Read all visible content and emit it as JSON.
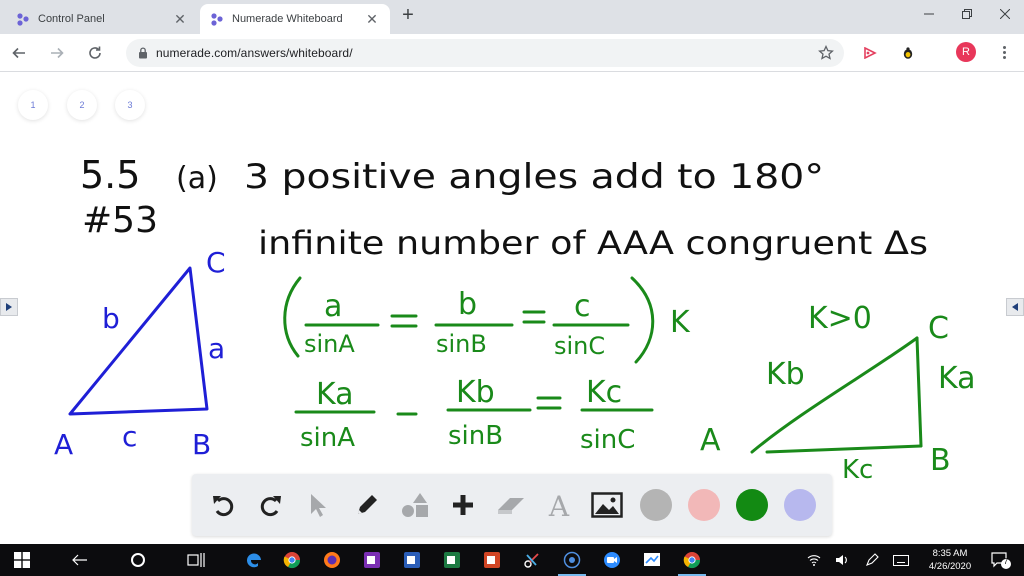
{
  "browser": {
    "tabs": [
      {
        "title": "Control Panel",
        "close": "✕"
      },
      {
        "title": "Numerade Whiteboard",
        "close": "✕"
      }
    ],
    "new_tab": "+",
    "url": "numerade.com/answers/whiteboard/",
    "profile_initial": "R"
  },
  "whiteboard": {
    "page_buttons": [
      "1",
      "2",
      "3"
    ],
    "notes": {
      "line1_section": "5.5",
      "line1_part": "(a)",
      "line1_text": "3 positive angles add to 180°",
      "line2_number": "#53",
      "line2_text": "infinite number of AAA congruent Δs",
      "tri1_vertex_c": "C",
      "tri1_vertex_a": "A",
      "tri1_vertex_b": "B",
      "tri1_side_b": "b",
      "tri1_side_a": "a",
      "tri1_side_c": "c",
      "eq1_num_a": "a",
      "eq1_den_a": "sinA",
      "eq1_num_b": "b",
      "eq1_den_b": "sinB",
      "eq1_num_c": "c",
      "eq1_den_c": "sinC",
      "eq1_factor": "K",
      "eq2_num_a": "Ka",
      "eq2_den_a": "sinA",
      "eq2_num_b": "Kb",
      "eq2_den_b": "sinB",
      "eq2_num_c": "Kc",
      "eq2_den_c": "sinC",
      "k_condition": "K>0",
      "tri2_vertex_c": "C",
      "tri2_vertex_a": "A",
      "tri2_vertex_b": "B",
      "tri2_side_kb": "Kb",
      "tri2_side_ka": "Ka",
      "tri2_side_kc": "Kc"
    },
    "colors": {
      "ink_black": "#111111",
      "ink_blue": "#1f1fd6",
      "ink_green": "#1a8a1a",
      "accent": "#6c7bd6"
    }
  },
  "drawing_toolbar": {
    "tools": [
      "undo-icon",
      "redo-icon",
      "pointer-icon",
      "pencil-icon",
      "shapes-icon",
      "plus-icon",
      "eraser-icon",
      "text-icon",
      "image-icon"
    ],
    "text_tool_glyph": "A",
    "swatches": [
      "#b4b4b4",
      "#f2b8b8",
      "#138a13",
      "#b7b8ee"
    ]
  },
  "taskbar": {
    "time": "8:35 AM",
    "date": "4/26/2020",
    "notification_count": "7"
  }
}
